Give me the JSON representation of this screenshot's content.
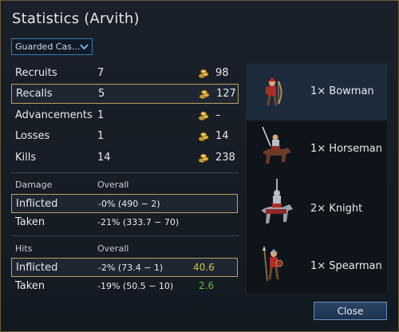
{
  "dialog": {
    "title": "Statistics (Arvith)",
    "scenario_select": "Guarded Cas...",
    "close_label": "Close"
  },
  "stats": [
    {
      "label": "Recruits",
      "value": "7",
      "cost": "98",
      "selected": false
    },
    {
      "label": "Recalls",
      "value": "5",
      "cost": "127",
      "selected": true
    },
    {
      "label": "Advancements",
      "value": "1",
      "cost": "–",
      "selected": false
    },
    {
      "label": "Losses",
      "value": "1",
      "cost": "14",
      "selected": false
    },
    {
      "label": "Kills",
      "value": "14",
      "cost": "238",
      "selected": false
    }
  ],
  "damage": {
    "header": "Damage",
    "overall_header": "Overall",
    "inflicted_label": "Inflicted",
    "inflicted_value": "-0% (490 − 2)",
    "taken_label": "Taken",
    "taken_value": "-21% (333.7 − 70)"
  },
  "hits": {
    "header": "Hits",
    "overall_header": "Overall",
    "inflicted_label": "Inflicted",
    "inflicted_value": "-2% (73.4 − 1)",
    "inflicted_extra": "40.6",
    "taken_label": "Taken",
    "taken_value": "-19% (50.5 − 10)",
    "taken_extra": "2.6"
  },
  "units": [
    {
      "label": "1× Bowman",
      "icon": "bowman-sprite"
    },
    {
      "label": "1× Horseman",
      "icon": "horseman-sprite"
    },
    {
      "label": "2× Knight",
      "icon": "knight-sprite"
    },
    {
      "label": "1× Spearman",
      "icon": "spearman-sprite"
    }
  ],
  "colors": {
    "gold": "#b6a35e",
    "extra_yellow": "#d2c53a",
    "extra_green": "#5fc23b",
    "accent_blue": "#3b78b1"
  }
}
